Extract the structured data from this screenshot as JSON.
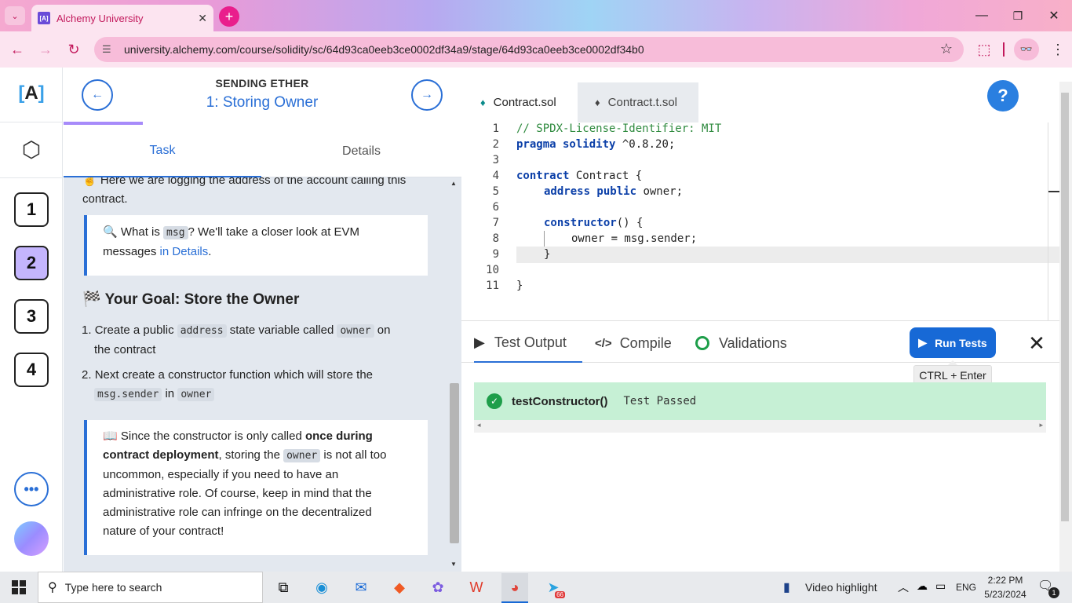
{
  "browser": {
    "tab_title": "Alchemy University",
    "tab_favicon_text": "[A]",
    "url": "university.alchemy.com/course/solidity/sc/64d93ca0eeb3ce0002df34a9/stage/64d93ca0eeb3ce0002df34b0"
  },
  "rail": {
    "logo_text": "A",
    "stages": [
      "1",
      "2",
      "3",
      "4"
    ],
    "active_stage": "2"
  },
  "lesson": {
    "section_title": "SENDING ETHER",
    "stage_title": "1: Storing Owner",
    "tabs": [
      "Task",
      "Details"
    ],
    "intro_text": "Here we are logging the address of the account calling this",
    "intro_text_2": "contract.",
    "callout1": {
      "pre": "What is",
      "code": "msg",
      "mid": "? We'll take a closer look at EVM",
      "line2": "messages",
      "link": "in Details",
      "end": "."
    },
    "goal_title": "Your Goal: Store the Owner",
    "step1": {
      "n": "1.",
      "a": "Create a public",
      "code1": "address",
      "b": "state variable called",
      "code2": "owner",
      "c": "on",
      "d": "the contract"
    },
    "step2": {
      "n": "2.",
      "a": "Next create a constructor function which will store the",
      "code1": "msg.sender",
      "b": "in",
      "code2": "owner"
    },
    "callout2": {
      "l1a": "Since the constructor is only called",
      "l1b": "once during",
      "l2a": "contract deployment",
      "l2b": ", storing the",
      "l2code": "owner",
      "l2c": "is not all too",
      "l3": "uncommon, especially if you need to have an",
      "l4": "administrative role. Of course, keep in mind that the",
      "l5": "administrative role can infringe on the decentralized",
      "l6": "nature of your contract!"
    }
  },
  "editor": {
    "tabs": [
      "Contract.sol",
      "Contract.t.sol"
    ],
    "help_label": "?",
    "line_numbers": [
      "1",
      "2",
      "3",
      "4",
      "5",
      "6",
      "7",
      "8",
      "9",
      "10",
      "11"
    ],
    "code": {
      "l1": "// SPDX-License-Identifier: MIT",
      "l2kw": "pragma solidity",
      "l2rest": " ^0.8.20;",
      "l4kw": "contract",
      "l4rest": " Contract {",
      "l5kw": "address public",
      "l5rest": " owner;",
      "l7kw": "constructor",
      "l7rest": "() {",
      "l8": "owner = msg.sender;",
      "l9": "}",
      "l11": "}"
    }
  },
  "output": {
    "tabs": [
      "Test Output",
      "Compile",
      "Validations"
    ],
    "run_label": "Run Tests",
    "tooltip": "CTRL + Enter",
    "result_name": "testConstructor()",
    "result_status": "Test Passed"
  },
  "taskbar": {
    "search_placeholder": "Type here to search",
    "video_label": "Video highlight",
    "lang": "ENG",
    "time": "2:22 PM",
    "date": "5/23/2024",
    "notif_count": "1",
    "telegram_badge": "66"
  },
  "colors": {
    "accent": "#2a6fd6",
    "pass_bg": "#c6f0d5",
    "active_stage": "#c4b5fd"
  }
}
